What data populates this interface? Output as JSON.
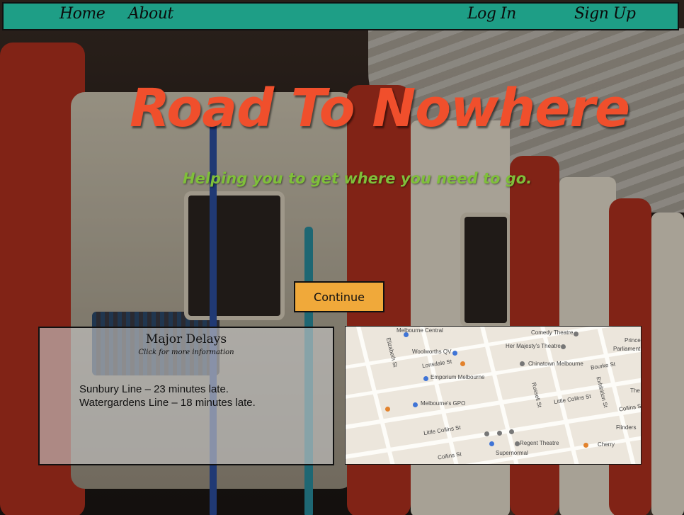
{
  "nav": {
    "home": "Home",
    "about": "About",
    "login": "Log In",
    "signup": "Sign Up"
  },
  "hero": {
    "title": "Road To Nowhere",
    "subtitle": "Helping you to get where you need to go."
  },
  "continue_label": "Continue",
  "delays": {
    "heading": "Major Delays",
    "subheading": "Click for more information",
    "items": [
      "Sunbury Line – 23 minutes late.",
      "Watergardens Line – 18 minutes late."
    ]
  },
  "map": {
    "labels": [
      "Melbourne Central",
      "Comedy Theatre",
      "Her Majesty's Theatre",
      "Princess",
      "Parliament",
      "Woolworths QV",
      "Lonsdale St",
      "Chinatown Melbourne",
      "Bourke St",
      "Emporium Melbourne",
      "Russell St",
      "Exhibition St",
      "Little Collins St",
      "The",
      "Melbourne's GPO",
      "Collins St",
      "Regent Theatre",
      "Cherry",
      "Little Collins St",
      "Supernormal",
      "Collins St",
      "Flinders",
      "Elizabeth St"
    ]
  },
  "colors": {
    "nav": "#1e9e86",
    "title": "#f04f2c",
    "subtitle": "#7fbf3a",
    "button": "#f0a93a"
  }
}
